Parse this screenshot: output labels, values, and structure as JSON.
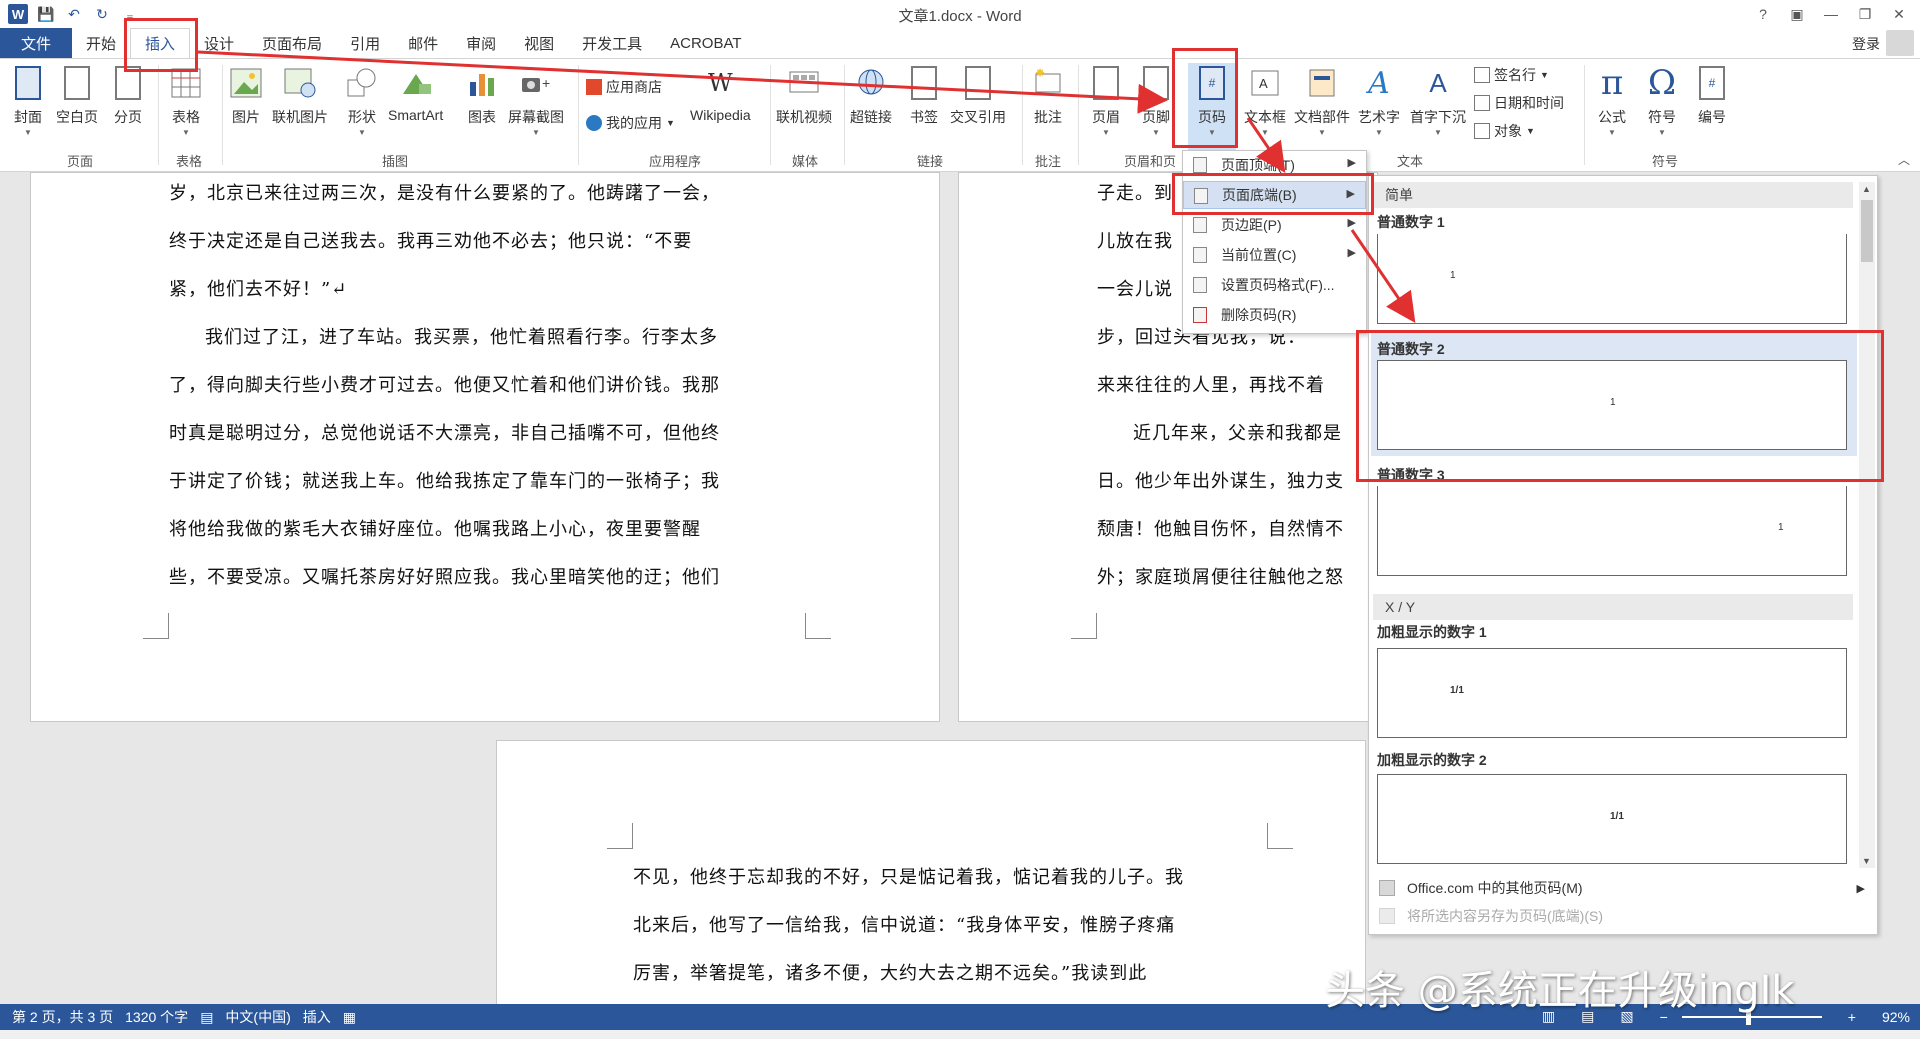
{
  "window": {
    "title": "文章1.docx - Word",
    "help": "?",
    "restore_ribbon": "▣",
    "minimize": "—",
    "maximize": "❐",
    "close": "✕"
  },
  "qat": {
    "save": "💾",
    "undo": "↶",
    "redo": "↻",
    "customize": "₌"
  },
  "tabs": {
    "file": "文件",
    "home": "开始",
    "insert": "插入",
    "design": "设计",
    "layout": "页面布局",
    "references": "引用",
    "mailings": "邮件",
    "review": "审阅",
    "view": "视图",
    "developer": "开发工具",
    "acrobat": "ACROBAT",
    "login": "登录"
  },
  "ribbon": {
    "cover": "封面",
    "blank_page": "空白页",
    "page_break": "分页",
    "table": "表格",
    "picture": "图片",
    "online_picture": "联机图片",
    "shapes": "形状",
    "smartart": "SmartArt",
    "chart": "图表",
    "screenshot": "屏幕截图",
    "app_store": "应用商店",
    "my_apps": "我的应用",
    "wikipedia": "Wikipedia",
    "online_video": "联机视频",
    "hyperlink": "超链接",
    "bookmark": "书签",
    "cross_ref": "交叉引用",
    "comment": "批注",
    "header": "页眉",
    "footer": "页脚",
    "page_number": "页码",
    "textbox": "文本框",
    "quick_parts": "文档部件",
    "wordart": "艺术字",
    "dropcap": "首字下沉",
    "signature": "签名行",
    "datetime": "日期和时间",
    "object": "对象",
    "equation": "公式",
    "symbol": "符号",
    "numbering": "编号",
    "groups": {
      "pages": "页面",
      "tables": "表格",
      "illustrations": "插图",
      "apps": "应用程序",
      "media": "媒体",
      "links": "链接",
      "comments": "批注",
      "header_footer": "页眉和页",
      "text": "文本",
      "symbols": "符号"
    }
  },
  "doc_left": [
    "岁，北京已来往过两三次，是没有什么要紧的了。他踌躇了一会，",
    "终于决定还是自己送我去。我再三劝他不必去；他只说：“不要",
    "紧，他们去不好！”↵",
    "我们过了江，进了车站。我买票，他忙着照看行李。行李太多",
    "了，得向脚夫行些小费才可过去。他便又忙着和他们讲价钱。我那",
    "时真是聪明过分，总觉他说话不大漂亮，非自己插嘴不可，但他终",
    "于讲定了价钱；就送我上车。他给我拣定了靠车门的一张椅子；我",
    "将他给我做的紫毛大衣铺好座位。他嘱我路上小心，夜里要警醒",
    "些，不要受凉。又嘱托茶房好好照应我。我心里暗笑他的迂；他们"
  ],
  "doc_right": [
    "子走。到",
    "儿放在我",
    "一会儿说",
    "步，回过头看见我，说：",
    "来来往往的人里，再找不着",
    "近几年来，父亲和我都是",
    "日。他少年出外谋生，独力支",
    "颓唐！他触目伤怀，自然情不",
    "外；家庭琐屑便往往触他之怒"
  ],
  "doc_bottom": [
    "不见，他终于忘却我的不好，只是惦记着我，惦记着我的儿子。我",
    "北来后，他写了一信给我，信中说道：“我身体平安，惟膀子疼痛",
    "厉害，举箸提笔，诸多不便，大约大去之期不远矣。”我读到此"
  ],
  "page_number_menu": [
    {
      "label": "页面顶端(T)",
      "has_submenu": true
    },
    {
      "label": "页面底端(B)",
      "has_submenu": true
    },
    {
      "label": "页边距(P)",
      "has_submenu": true
    },
    {
      "label": "当前位置(C)",
      "has_submenu": true
    },
    {
      "label": "设置页码格式(F)...",
      "has_submenu": false
    },
    {
      "label": "删除页码(R)",
      "has_submenu": false
    }
  ],
  "gallery": {
    "section_simple": "简单",
    "plain1": "普通数字 1",
    "plain2": "普通数字 2",
    "plain3": "普通数字 3",
    "section_xy": "X / Y",
    "bold1": "加粗显示的数字 1",
    "bold2": "加粗显示的数字 2",
    "num_plain": "1",
    "num_xy": "1/1",
    "more_office": "Office.com 中的其他页码(M)",
    "save_selection": "将所选内容另存为页码(底端)(S)"
  },
  "status": {
    "page": "第 2 页，共 3 页",
    "words": "1320 个字",
    "language": "中文(中国)",
    "mode": "插入",
    "zoom": "92%"
  },
  "watermark": "头条 @系统正在升级ingIk",
  "colors": {
    "accent": "#2b579a",
    "annotation": "#e03030"
  }
}
